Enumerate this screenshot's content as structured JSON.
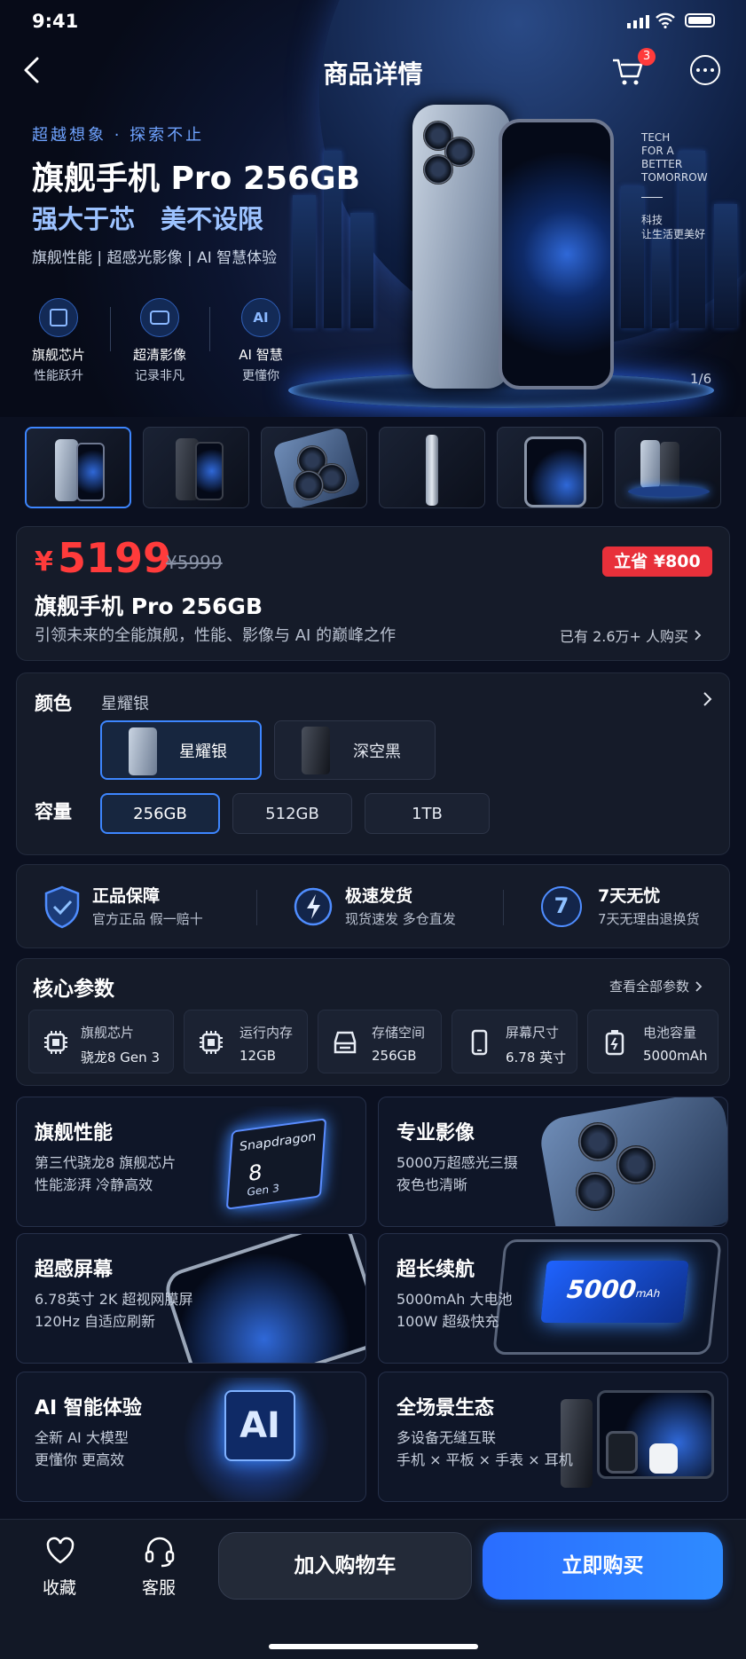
{
  "status_bar": {
    "time": "9:41"
  },
  "nav": {
    "title": "商品详情",
    "cart_badge": "3"
  },
  "hero": {
    "slogan": "超越想象 · 探索不止",
    "title": "旗舰手机 Pro 256GB",
    "subtitle": "强大于芯　美不设限",
    "tagline": "旗舰性能 | 超感光影像 | AI 智慧体验",
    "side_text_en": [
      "TECH",
      "FOR A",
      "BETTER",
      "TOMORROW"
    ],
    "side_text_cn": [
      "科技",
      "让生活更美好"
    ],
    "counter": "1/6",
    "features": [
      {
        "title": "旗舰芯片",
        "desc": "性能跃升",
        "icon": "chip-icon"
      },
      {
        "title": "超清影像",
        "desc": "记录非凡",
        "icon": "camera-icon"
      },
      {
        "title": "AI 智慧",
        "desc": "更懂你",
        "icon": "ai-icon"
      }
    ]
  },
  "price": {
    "currency": "¥",
    "current": "5199",
    "original": "¥5999",
    "save_badge": "立省 ¥800",
    "name": "旗舰手机 Pro 256GB",
    "desc": "引领未来的全能旗舰，性能、影像与 AI 的巅峰之作",
    "sold": "已有 2.6万+ 人购买"
  },
  "spec": {
    "color_label": "颜色",
    "color_selected": "星耀银",
    "colors": [
      "星耀银",
      "深空黑"
    ],
    "capacity_label": "容量",
    "capacities": [
      "256GB",
      "512GB",
      "1TB"
    ]
  },
  "service": [
    {
      "title": "正品保障",
      "desc": "官方正品 假一赔十",
      "icon": "shield-check-icon"
    },
    {
      "title": "极速发货",
      "desc": "现货速发 多仓直发",
      "icon": "lightning-icon"
    },
    {
      "title": "7天无忧",
      "desc": "7天无理由退换货",
      "icon": "seven-day-icon",
      "glyph": "7"
    }
  ],
  "params": {
    "title": "核心参数",
    "view_all": "查看全部参数",
    "items": [
      {
        "name": "旗舰芯片",
        "value": "骁龙8 Gen 3",
        "icon": "chip-icon"
      },
      {
        "name": "运行内存",
        "value": "12GB",
        "icon": "memory-chip-icon"
      },
      {
        "name": "存储空间",
        "value": "256GB",
        "icon": "storage-icon"
      },
      {
        "name": "屏幕尺寸",
        "value": "6.78 英寸",
        "icon": "phone-screen-icon"
      },
      {
        "name": "电池容量",
        "value": "5000mAh",
        "icon": "battery-icon"
      }
    ]
  },
  "features": [
    {
      "title": "旗舰性能",
      "lines": [
        "第三代骁龙8 旗舰芯片",
        "性能澎湃 冷静高效"
      ],
      "chip_text": [
        "Snapdragon",
        "8",
        "Gen 3"
      ]
    },
    {
      "title": "专业影像",
      "lines": [
        "5000万超感光三摄",
        "夜色也清晰"
      ]
    },
    {
      "title": "超感屏幕",
      "lines": [
        "6.78英寸 2K 超视网膜屏",
        "120Hz 自适应刷新"
      ]
    },
    {
      "title": "超长续航",
      "lines": [
        "5000mAh 大电池",
        "100W 超级快充"
      ],
      "battery_text": "5000",
      "battery_unit": "mAh"
    },
    {
      "title": "AI 智能体验",
      "lines": [
        "全新 AI 大模型",
        "更懂你 更高效"
      ],
      "ai_text": "AI"
    },
    {
      "title": "全场景生态",
      "lines": [
        "多设备无缝互联",
        "手机 × 平板 × 手表 × 耳机"
      ]
    }
  ],
  "bottom": {
    "fav": "收藏",
    "service": "客服",
    "add_cart": "加入购物车",
    "buy_now": "立即购买"
  },
  "colors": {
    "accent": "#2f7bff",
    "price_red": "#ff3b3b",
    "bg": "#0b1020"
  }
}
